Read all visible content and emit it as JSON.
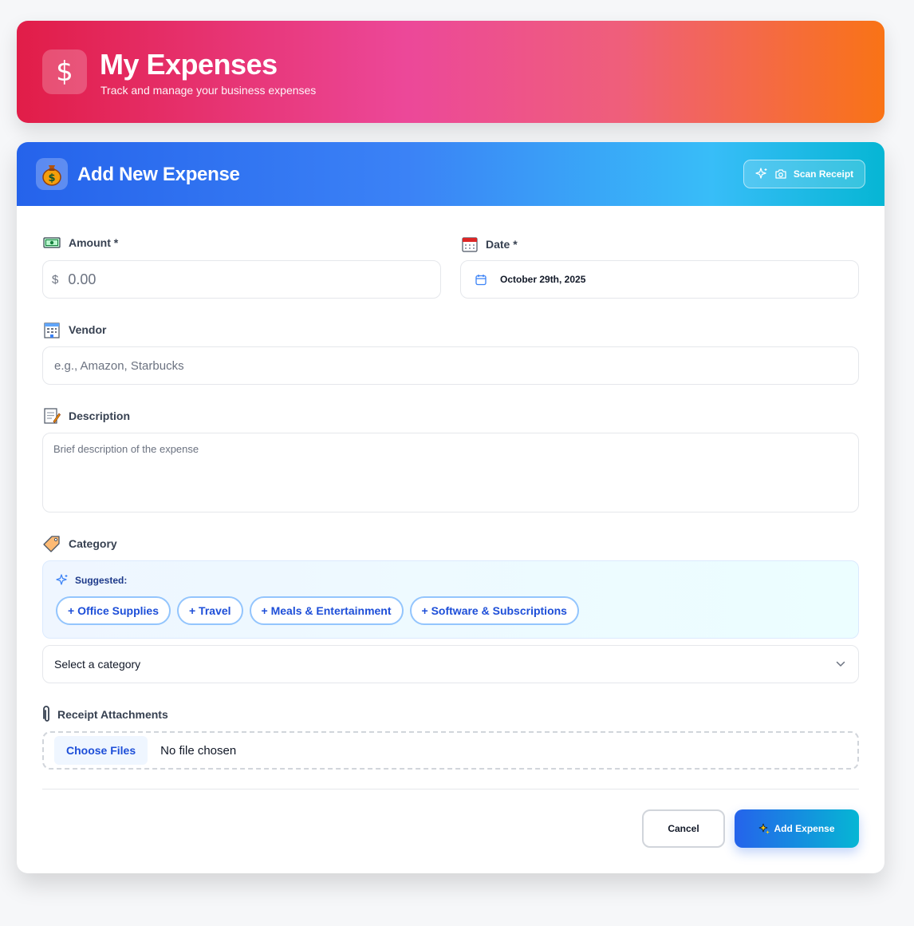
{
  "header": {
    "icon": "dollar-sign-icon",
    "title": "My Expenses",
    "subtitle": "Track and manage your business expenses"
  },
  "form": {
    "icon": "money-bag-icon",
    "title": "Add New Expense",
    "scan_label": "Scan Receipt",
    "amount": {
      "label": "Amount *",
      "icon": "banknote-icon",
      "currency": "$",
      "placeholder": "0.00"
    },
    "date": {
      "label": "Date *",
      "icon": "calendar-icon",
      "value": "October 29th, 2025"
    },
    "vendor": {
      "label": "Vendor",
      "icon": "office-building-icon",
      "placeholder": "e.g., Amazon, Starbucks"
    },
    "description": {
      "label": "Description",
      "icon": "memo-icon",
      "placeholder": "Brief description of the expense"
    },
    "category": {
      "label": "Category",
      "icon": "tag-icon",
      "suggested_label": "Suggested:",
      "suggestions": [
        "+ Office Supplies",
        "+ Travel",
        "+ Meals & Entertainment",
        "+ Software & Subscriptions"
      ],
      "select_value": "Select a category"
    },
    "receipt": {
      "label": "Receipt Attachments",
      "icon": "paperclip-icon",
      "choose_label": "Choose Files",
      "status": "No file chosen"
    },
    "cancel_label": "Cancel",
    "submit_label": "Add Expense"
  },
  "colors": {
    "header_gradient": [
      "#e11d48",
      "#ec4899",
      "#f97316"
    ],
    "card_gradient": [
      "#2563eb",
      "#3b82f6",
      "#06b6d4"
    ],
    "accent": "#1d4ed8"
  }
}
